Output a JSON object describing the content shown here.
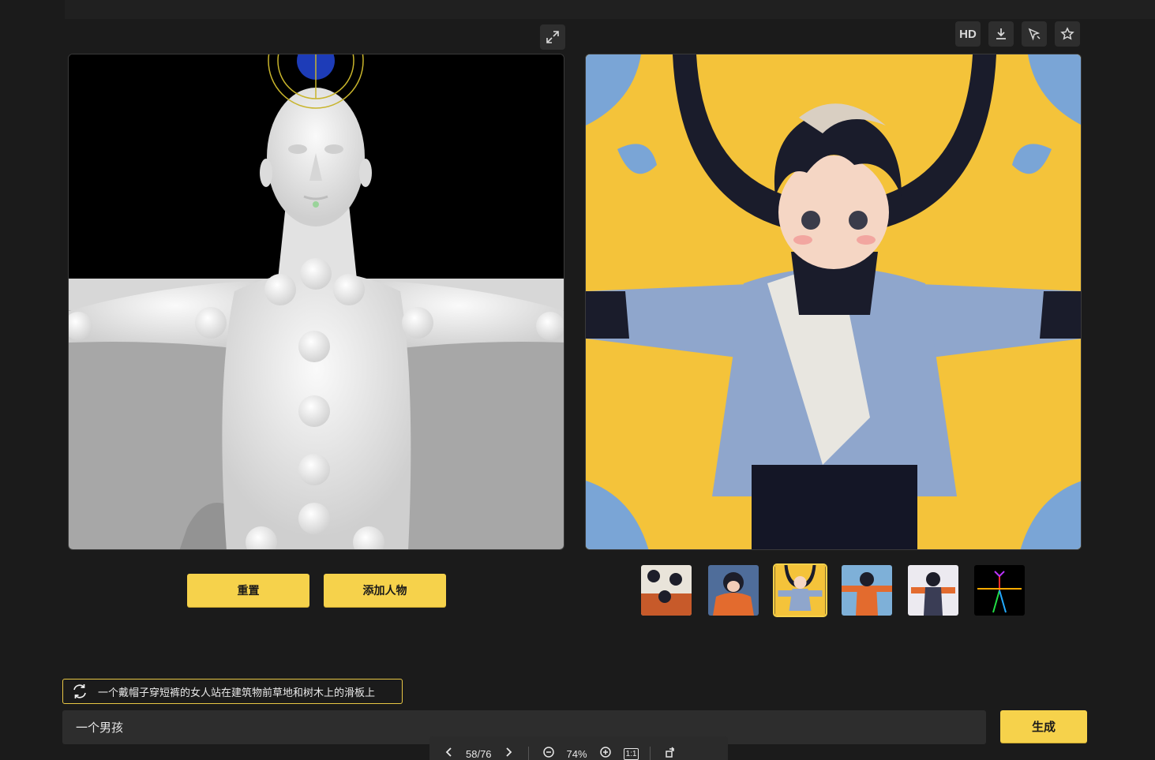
{
  "toolbar": {
    "hd_label": "HD",
    "icons": [
      "expand-icon",
      "download-icon",
      "cursor-icon",
      "star-icon"
    ]
  },
  "actions": {
    "reset_label": "重置",
    "add_person_label": "添加人物",
    "generate_label": "生成"
  },
  "thumbnails": [
    {
      "name": "thumbnail-1",
      "active": false
    },
    {
      "name": "thumbnail-2",
      "active": false
    },
    {
      "name": "thumbnail-3",
      "active": true
    },
    {
      "name": "thumbnail-4",
      "active": false
    },
    {
      "name": "thumbnail-5",
      "active": false
    },
    {
      "name": "thumbnail-pose-skeleton",
      "active": false
    }
  ],
  "hint": {
    "text": "一个戴帽子穿短裤的女人站在建筑物前草地和树木上的滑板上"
  },
  "prompt": {
    "value": "一个男孩"
  },
  "viewer": {
    "page": "58/76",
    "zoom": "74%",
    "actual_size": "1:1"
  },
  "colors": {
    "accent": "#f6d24b",
    "background": "#1b1b1b",
    "panel": "#2d2d2d"
  }
}
